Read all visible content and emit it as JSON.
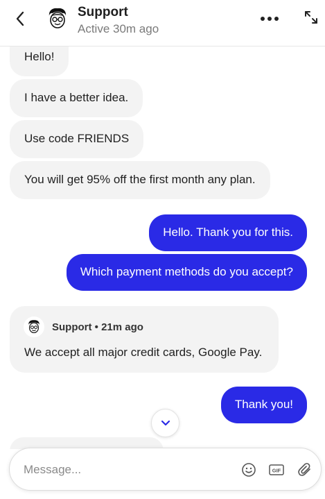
{
  "header": {
    "title": "Support",
    "status": "Active 30m ago"
  },
  "messages": [
    {
      "from": "agent",
      "text": "Hello!"
    },
    {
      "from": "agent",
      "text": "I have a better idea."
    },
    {
      "from": "agent",
      "text": "Use code FRIENDS"
    },
    {
      "from": "agent",
      "text": "You will get 95% off the first month any plan."
    },
    {
      "from": "user",
      "text": "Hello. Thank you for this."
    },
    {
      "from": "user",
      "text": "Which payment methods do you accept?"
    },
    {
      "from": "agent",
      "author": "Support",
      "time": "21m ago",
      "author_line": "Support • 21m ago",
      "text": "We accept all major credit cards, Google Pay."
    },
    {
      "from": "user",
      "text": "Thank you!"
    }
  ],
  "composer": {
    "placeholder": "Message...",
    "gif_label": "GIF"
  },
  "icons": {
    "back": "chevron-left-icon",
    "more": "more-horizontal-icon",
    "expand": "expand-icon",
    "scroll_down": "chevron-down-icon",
    "emoji": "smiley-icon",
    "gif": "gif-icon",
    "attach": "paperclip-icon"
  },
  "colors": {
    "accent": "#2a2ae6",
    "incoming_bubble": "#f3f3f3",
    "muted_text": "#7a7a7a"
  }
}
